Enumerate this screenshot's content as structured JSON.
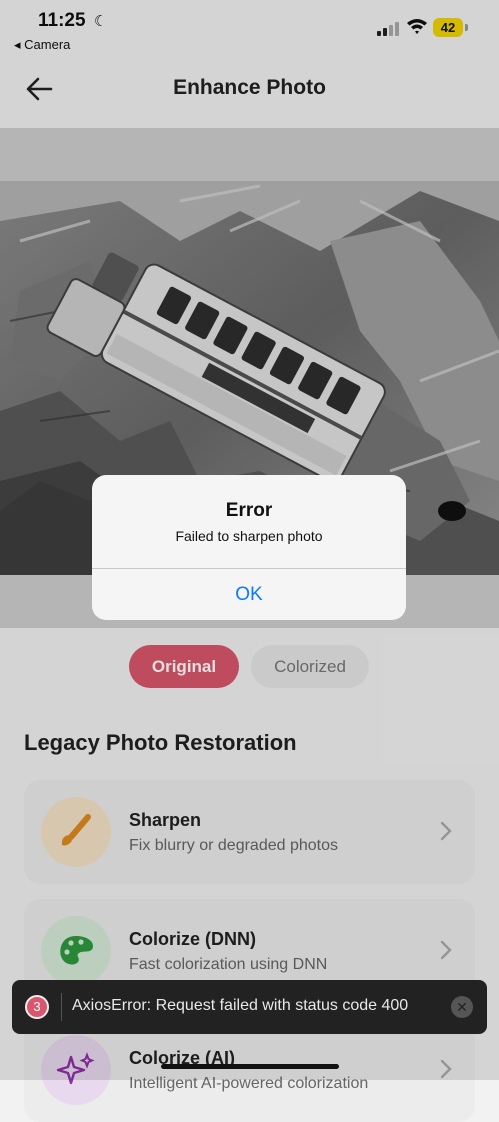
{
  "status_bar": {
    "time": "11:25",
    "back_app": "◂ Camera",
    "battery": "42"
  },
  "header": {
    "title": "Enhance Photo"
  },
  "toggle": {
    "original": "Original",
    "colorized": "Colorized",
    "active": "Original"
  },
  "section": {
    "title": "Legacy Photo Restoration"
  },
  "tools": [
    {
      "title": "Sharpen",
      "subtitle": "Fix blurry or degraded photos",
      "icon": "paintbrush-icon"
    },
    {
      "title": "Colorize (DNN)",
      "subtitle": "Fast colorization using DNN",
      "icon": "palette-icon"
    },
    {
      "title": "Colorize (AI)",
      "subtitle": "Intelligent AI-powered colorization",
      "icon": "sparkles-icon"
    }
  ],
  "alert": {
    "title": "Error",
    "message": "Failed to sharpen photo",
    "ok": "OK"
  },
  "toast": {
    "count": "3",
    "message": "AxiosError: Request failed with status code 400"
  },
  "colors": {
    "accent": "#d9566c",
    "link": "#0a7aff"
  }
}
